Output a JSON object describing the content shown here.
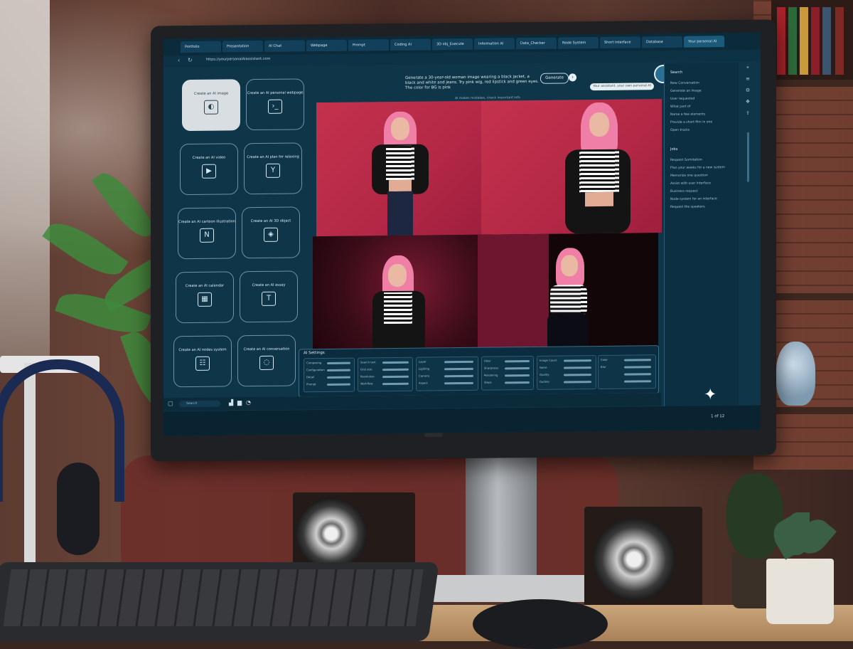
{
  "browser": {
    "url": "https://yourpersonalAIassistant.com",
    "tabs": [
      "Portfolio",
      "Presentation",
      "AI Chat",
      "Webpage",
      "Prompt",
      "Coding AI",
      "3D obj_Execute",
      "Information AI",
      "Data_Checker",
      "Node System",
      "Short Interface",
      "Database",
      "Your personal AI"
    ]
  },
  "tools": [
    {
      "label": "Create an AI image",
      "icon": "image-icon"
    },
    {
      "label": "Create an AI personal webpage",
      "icon": "terminal-icon"
    },
    {
      "label": "Create an AI video",
      "icon": "play-icon"
    },
    {
      "label": "Create an AI plan for relaxing",
      "icon": "cocktail-icon"
    },
    {
      "label": "Create an AI cartoon illustration",
      "icon": "notebook-icon"
    },
    {
      "label": "Create an AI 3D object",
      "icon": "cube-icon"
    },
    {
      "label": "Create an AI calendar",
      "icon": "calendar-icon"
    },
    {
      "label": "Create an AI essay",
      "icon": "text-icon"
    },
    {
      "label": "Create an AI nodes system",
      "icon": "nodes-icon"
    },
    {
      "label": "Create an AI conversation",
      "icon": "chat-icon"
    }
  ],
  "prompt": {
    "text": "Generate a 30-year-old woman image wearing a black jacket, a black and white and jeans. Try pink wig, red lipstick and green eyes. The color for BG is pink",
    "note": "AI makes mistakes, check important info.",
    "generate_label": "Generate",
    "assistant_label": "Your assistant, your own personal AI"
  },
  "right_panel": {
    "section1_title": "Search",
    "section1_items": [
      "New Conversation",
      "Generate an image",
      "User requested",
      "What part of",
      "Name a few elements",
      "Provide a short film in one",
      "Open tracks"
    ],
    "section2_title": "Jobs",
    "section2_items": [
      "Request Gomitation",
      "Plan your weeks for a new system",
      "Memorize one question",
      "Assist with user interface",
      "Business request",
      "Node system for an interface",
      "Request the speakers"
    ]
  },
  "settings": {
    "title": "AI Settings",
    "labels": [
      "Composing",
      "Configuration",
      "Detail",
      "Prompt",
      "Search text",
      "Grid size",
      "Resolution",
      "Workflow",
      "Layer",
      "Lighting",
      "Camera",
      "Aspect",
      "Filter",
      "Sharpness",
      "Rendering",
      "Steps",
      "Image Count",
      "Noise",
      "Quality",
      "Outline",
      "Color",
      "Blur"
    ]
  },
  "taskbar": {
    "search_placeholder": "Search"
  },
  "page_indicator": "1 of 12",
  "colors": {
    "screen_bg": "#0f3548",
    "accent": "#c4324d",
    "hair": "#f07fa8"
  }
}
